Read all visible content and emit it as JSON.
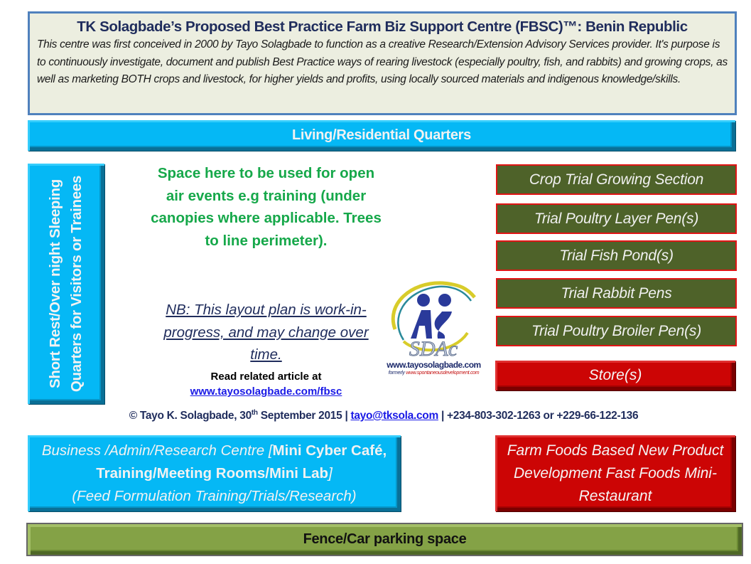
{
  "header": {
    "title": "TK Solagbade’s Proposed Best Practice Farm Biz Support Centre (FBSC)™: Benin Republic",
    "description": "This centre was first conceived in 2000 by Tayo Solagbade to function as a creative Research/Extension Advisory Services provider. It's purpose is to continuously investigate, document and publish Best Practice ways of rearing livestock (especially poultry, fish, and rabbits) and growing crops, as well as marketing BOTH crops and livestock, for higher yields and profits, using locally sourced materials and indigenous knowledge/skills."
  },
  "zones": {
    "living": "Living/Residential Quarters",
    "sleeping": "Short Rest/Over night Sleeping Quarters for Visitors or Trainees",
    "open_air": "Space here to be used for open air events e.g training (under canopies where applicable. Trees to line perimeter).",
    "nb_note": "NB: This layout plan is work-in-progress, and may change over time.",
    "read_related": "Read related article at",
    "read_link": "www.tayosolagbade.com/fbsc",
    "trial_sections": [
      {
        "label": "Crop Trial Growing Section"
      },
      {
        "label": "Trial Poultry Layer Pen(s)"
      },
      {
        "label": "Trial Fish Pond(s)"
      },
      {
        "label": "Trial Rabbit Pens"
      },
      {
        "label": "Trial Poultry Broiler Pen(s)"
      }
    ],
    "store": "Store(s)",
    "business_italic_1": "Business /Admin/Research Centre [",
    "business_bold": "Mini Cyber Café, Training/Meeting Rooms/Mini Lab",
    "business_italic_2": "]",
    "business_line3": "(Feed Formulation Training/Trials/Research)",
    "farm_foods": "Farm Foods Based New Product Development Fast Foods Mini-Restaurant",
    "fence": "Fence/Car parking space"
  },
  "logo": {
    "letters": "SDAc",
    "site": "www.tayosolagbade.com",
    "formerly_prefix": "formerly",
    "formerly_site": "www.spontaneousdevelopment.com"
  },
  "footer": {
    "copyright_prefix": "© Tayo K. Solagbade, 30",
    "date_sup": "th",
    "date_rest": " September 2015 | ",
    "email": "tayo@tksola.com",
    "phones": " | +234-803-302-1263 or +229-66-122-136"
  },
  "colors": {
    "header_border": "#4f81bd",
    "blue_box": "#05b8f5",
    "red_box": "#cc0505",
    "green_box": "#4e6229",
    "olive_bar": "#84a246",
    "open_air_text": "#16a84a"
  }
}
